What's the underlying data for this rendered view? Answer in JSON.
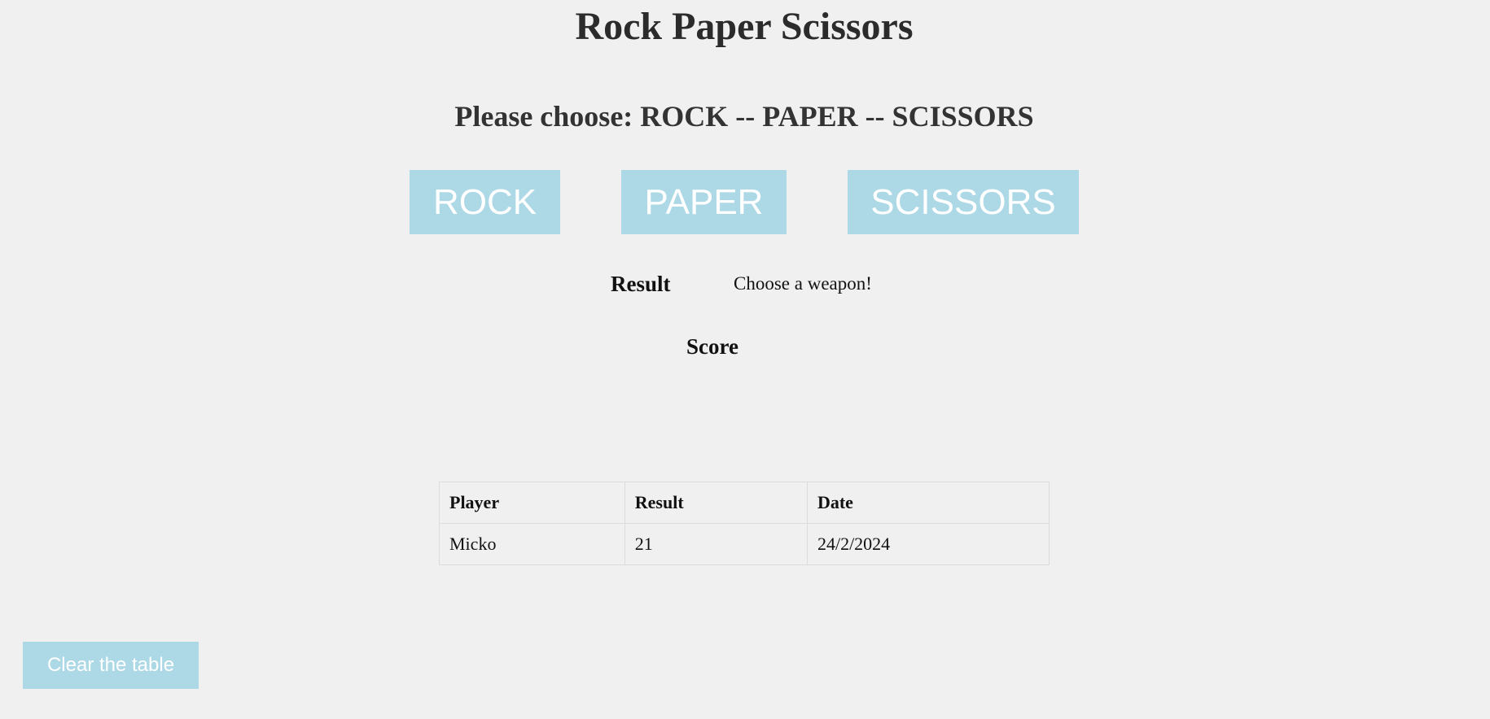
{
  "header": {
    "title": "Rock Paper Scissors",
    "prompt": "Please choose: ROCK -- PAPER -- SCISSORS"
  },
  "weapons": [
    {
      "label": "ROCK"
    },
    {
      "label": "PAPER"
    },
    {
      "label": "SCISSORS"
    }
  ],
  "result": {
    "label": "Result",
    "message": "Choose a weapon!"
  },
  "score": {
    "label": "Score"
  },
  "table": {
    "columns": [
      "Player",
      "Result",
      "Date"
    ],
    "rows": [
      [
        "Micko",
        "21",
        "24/2/2024"
      ]
    ]
  },
  "actions": {
    "clear_label": "Clear the table"
  },
  "colors": {
    "button_bg": "#add8e6",
    "button_text": "#ffffff",
    "page_bg": "#f0f0f0"
  }
}
